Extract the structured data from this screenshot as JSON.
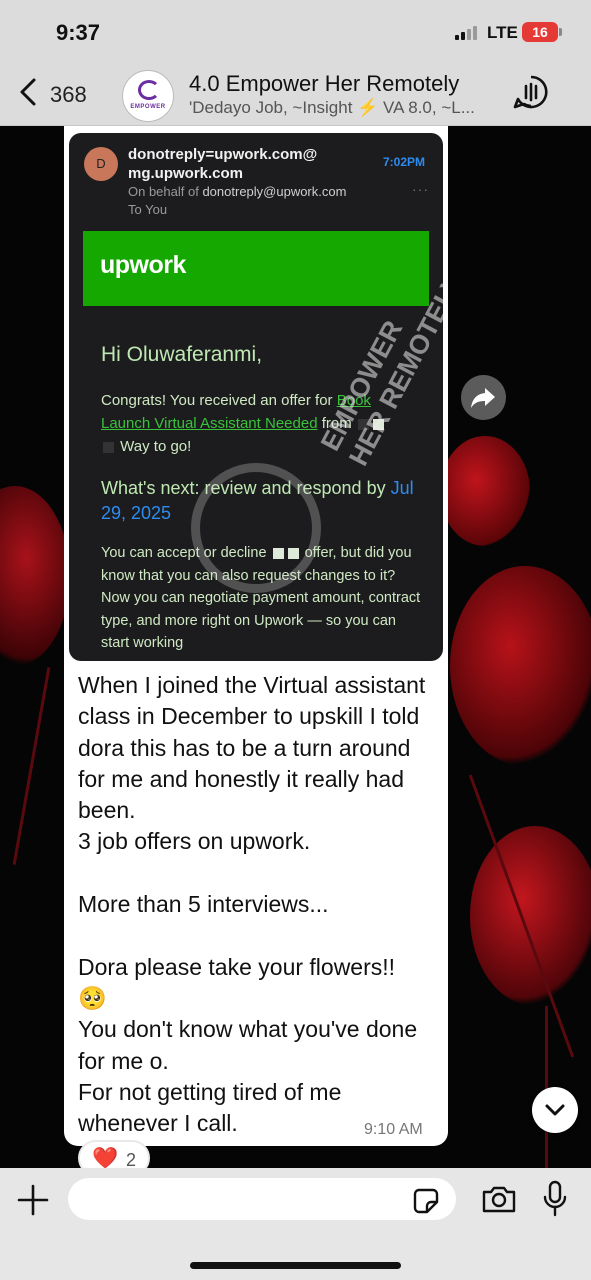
{
  "status_bar": {
    "time": "9:37",
    "network": "LTE",
    "battery": "16"
  },
  "header": {
    "back_count": "368",
    "group_name": "4.0 Empower Her Remotely",
    "members": "'Dedayo Job, ~Insight ⚡ VA 8.0, ~L...",
    "avatar_text": "EMPOWER"
  },
  "email": {
    "sender_initial": "D",
    "sender_address": "donotreply=upwork.com@mg.upwork.com",
    "time": "7:02PM",
    "on_behalf_prefix": "On behalf of ",
    "on_behalf_address": "donotreply@upwork.com",
    "to": "To You",
    "banner_logo": "upwork",
    "greeting": "Hi Oluwaferanmi,",
    "offer_prefix": "Congrats! You received an offer for ",
    "offer_link": "Book Launch Virtual Assistant Needed",
    "offer_from": " from ",
    "offer_suffix": " Way to go!",
    "whats_next": "What's next: review and respond by ",
    "due_date": "Jul 29, 2025",
    "body_prefix": "You can accept or decline ",
    "body_rest": " offer, but did you know that you can also request changes to it? Now you can negotiate payment amount, contract type, and more right on Upwork — so you can start working",
    "watermark": "EMPOWER\nHER REMOTELY"
  },
  "message": {
    "text": "When I joined the Virtual assistant class in December to upskill I told dora this has to be a turn around for me and honestly it really had been.\n3 job offers on upwork.\n\nMore than 5 interviews...\n\nDora please take your flowers!!\n🥺\nYou don't know what you've done for me o.\nFor not getting tired of me whenever I call.",
    "time": "9:10 AM"
  },
  "reaction": {
    "emoji": "❤️",
    "count": "2"
  },
  "composer": {
    "placeholder": ""
  },
  "colors": {
    "upwork_green": "#14a800",
    "link_blue": "#2d8cf0",
    "heart": "#e0102a"
  },
  "icons": [
    "back-icon",
    "call-icon",
    "forward-icon",
    "chevron-down-icon",
    "plus-icon",
    "sticker-icon",
    "camera-icon",
    "mic-icon"
  ]
}
